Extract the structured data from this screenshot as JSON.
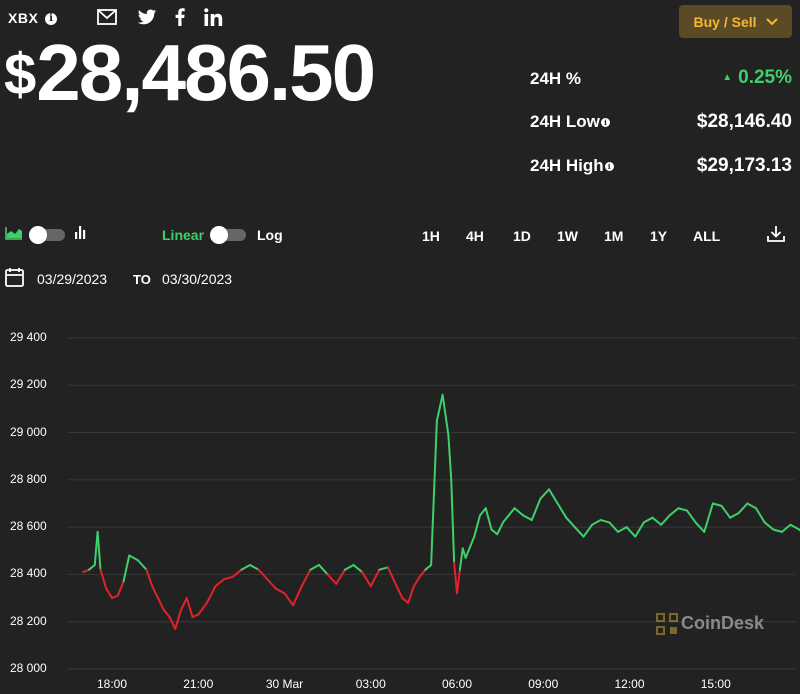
{
  "header": {
    "ticker": "XBX",
    "info_icon": "i",
    "price_currency": "$",
    "price_value": "28,486.50",
    "buy_sell_label": "Buy / Sell"
  },
  "share_icons": [
    "mail-icon",
    "twitter-icon",
    "facebook-icon",
    "linkedin-icon"
  ],
  "stats": {
    "change_label": "24H %",
    "change_value": "0.25%",
    "low_label": "24H Low",
    "low_value": "$28,146.40",
    "high_label": "24H High",
    "high_value": "$29,173.13"
  },
  "controls": {
    "linear_label": "Linear",
    "log_label": "Log",
    "ranges": [
      "1H",
      "4H",
      "1D",
      "1W",
      "1M",
      "1Y",
      "ALL"
    ],
    "active_range": "1D",
    "date_from": "03/29/2023",
    "date_to_label": "TO",
    "date_to": "03/30/2023"
  },
  "watermark": "CoinDesk",
  "colors": {
    "background": "#222222",
    "up": "#3fcf6a",
    "down": "#e0232b",
    "accent": "#f5b830",
    "button_bg": "#5a4a26"
  },
  "chart_data": {
    "type": "line",
    "ylim": [
      28000,
      29400
    ],
    "yticks": [
      "29 400",
      "29 200",
      "29 000",
      "28 800",
      "28 600",
      "28 400",
      "28 200",
      "28 000"
    ],
    "xticks": [
      "18:00",
      "21:00",
      "30 Mar",
      "03:00",
      "06:00",
      "09:00",
      "12:00",
      "15:00"
    ],
    "baseline": 28420,
    "x_hours": [
      17.0,
      17.2,
      17.4,
      17.5,
      17.6,
      17.8,
      18.0,
      18.2,
      18.4,
      18.6,
      18.9,
      19.2,
      19.4,
      19.6,
      19.8,
      20.0,
      20.2,
      20.4,
      20.6,
      20.8,
      21.0,
      21.3,
      21.6,
      21.9,
      22.2,
      22.5,
      22.8,
      23.1,
      23.4,
      23.7,
      24.0,
      24.3,
      24.6,
      24.9,
      25.2,
      25.5,
      25.8,
      26.1,
      26.4,
      26.7,
      27.0,
      27.3,
      27.6,
      27.9,
      28.1,
      28.3,
      28.5,
      28.7,
      28.9,
      29.1,
      29.3,
      29.5,
      29.7,
      29.8,
      29.9,
      30.0,
      30.1,
      30.2,
      30.3,
      30.4,
      30.6,
      30.8,
      31.0,
      31.2,
      31.4,
      31.6,
      31.8,
      32.0,
      32.3,
      32.6,
      32.9,
      33.2,
      33.5,
      33.8,
      34.1,
      34.4,
      34.7,
      35.0,
      35.3,
      35.6,
      35.9,
      36.2,
      36.5,
      36.8,
      37.1,
      37.4,
      37.7,
      38.0,
      38.3,
      38.6,
      38.9,
      39.2,
      39.5,
      39.8,
      40.1,
      40.4,
      40.7,
      41.0,
      41.3,
      41.6,
      41.9,
      42.2,
      42.4,
      42.6,
      42.8
    ],
    "values": [
      28410,
      28420,
      28440,
      28580,
      28420,
      28340,
      28300,
      28310,
      28370,
      28480,
      28460,
      28420,
      28350,
      28300,
      28250,
      28220,
      28170,
      28250,
      28300,
      28220,
      28230,
      28280,
      28350,
      28380,
      28390,
      28420,
      28440,
      28420,
      28380,
      28340,
      28320,
      28270,
      28350,
      28420,
      28440,
      28400,
      28360,
      28420,
      28440,
      28410,
      28350,
      28420,
      28430,
      28350,
      28300,
      28280,
      28350,
      28390,
      28420,
      28440,
      29050,
      29160,
      28990,
      28800,
      28450,
      28320,
      28420,
      28510,
      28470,
      28500,
      28560,
      28650,
      28680,
      28590,
      28570,
      28620,
      28650,
      28680,
      28650,
      28630,
      28720,
      28760,
      28700,
      28640,
      28600,
      28560,
      28610,
      28630,
      28620,
      28580,
      28600,
      28560,
      28620,
      28640,
      28610,
      28650,
      28680,
      28670,
      28620,
      28580,
      28700,
      28690,
      28640,
      28660,
      28700,
      28680,
      28620,
      28590,
      28580,
      28610,
      28590,
      28560,
      28520,
      28540,
      28480
    ]
  }
}
